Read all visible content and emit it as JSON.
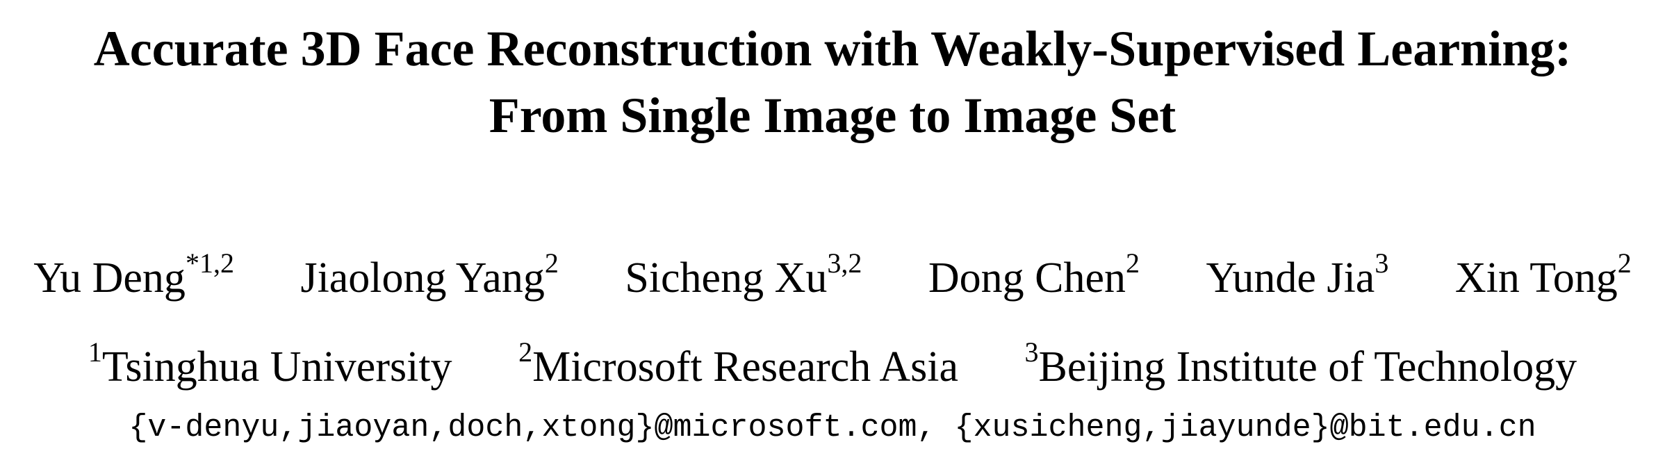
{
  "title": {
    "line1": "Accurate 3D Face Reconstruction with Weakly-Supervised Learning:",
    "line2": "From Single Image to Image Set"
  },
  "authors": [
    {
      "name": "Yu Deng",
      "sup": "*1,2"
    },
    {
      "name": "Jiaolong Yang",
      "sup": "2"
    },
    {
      "name": "Sicheng Xu",
      "sup": "3,2"
    },
    {
      "name": "Dong Chen",
      "sup": "2"
    },
    {
      "name": "Yunde Jia",
      "sup": "3"
    },
    {
      "name": "Xin Tong",
      "sup": "2"
    }
  ],
  "affiliations": [
    {
      "sup": "1",
      "name": "Tsinghua University"
    },
    {
      "sup": "2",
      "name": "Microsoft Research Asia"
    },
    {
      "sup": "3",
      "name": "Beijing Institute of Technology"
    }
  ],
  "emails": "{v-denyu,jiaoyan,doch,xtong}@microsoft.com, {xusicheng,jiayunde}@bit.edu.cn"
}
